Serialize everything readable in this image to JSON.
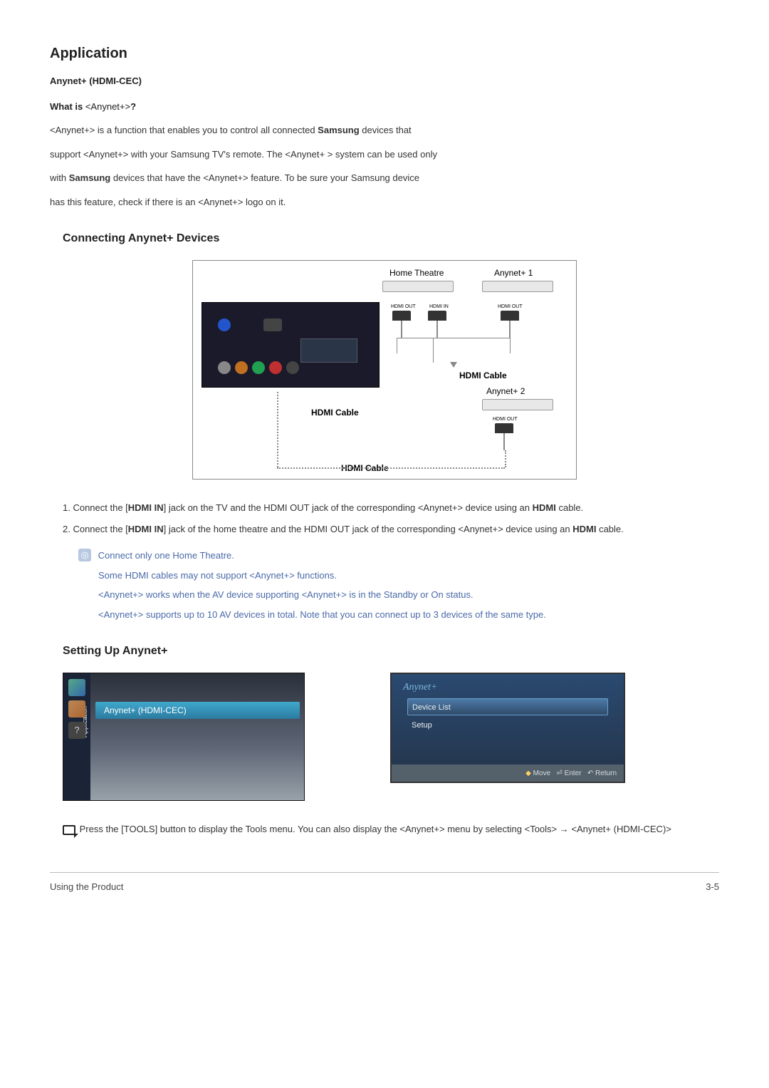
{
  "page_title": "Application",
  "feature_name": "Anynet+ (HDMI-CEC)",
  "what_is_html": "<b>What is </b><Anynet+><b>?</b>",
  "intro": {
    "l1_pre": "<Anynet+> is a function that enables you to control all connected ",
    "l1_bold": "Samsung",
    "l1_post": " devices that",
    "l2": "support <Anynet+> with your Samsung TV's remote. The <Anynet+ > system can be used only",
    "l3_pre": "with ",
    "l3_bold": "Samsung",
    "l3_post": " devices that have the <Anynet+> feature. To be sure your Samsung device",
    "l4": "has this feature, check if there is an <Anynet+> logo on it."
  },
  "section_connecting": "Connecting Anynet+ Devices",
  "diagram": {
    "home_theatre": "Home Theatre",
    "anynet1": "Anynet+ 1",
    "anynet2": "Anynet+ 2",
    "hdmi_cable": "HDMI Cable",
    "hdmi_out": "HDMI OUT",
    "hdmi_in": "HDMI IN"
  },
  "step1": {
    "pre": "1. Connect the [",
    "bold1": "HDMI IN",
    "mid": "] jack on the TV and the HDMI OUT jack of the corresponding <Anynet+> device using an ",
    "bold2": "HDMI",
    "post": " cable."
  },
  "step2": {
    "pre": "2. Connect the [",
    "bold1": "HDMI IN",
    "mid": "] jack of the home theatre and the HDMI OUT jack of the corresponding <Anynet+> device using an ",
    "bold2": "HDMI",
    "post": " cable."
  },
  "notes": [
    "Connect only one Home Theatre.",
    "Some HDMI cables may not support <Anynet+> functions.",
    "<Anynet+> works when the AV device supporting <Anynet+> is in the Standby or On status.",
    "<Anynet+> supports up to 10 AV devices in total. Note that you can connect up to 3 devices of the same type."
  ],
  "section_setting": "Setting Up Anynet+",
  "menu1": {
    "sidebar_label": "Application",
    "item": "Anynet+ (HDMI-CEC)"
  },
  "menu2": {
    "title": "Anynet+",
    "item1": "Device List",
    "item2": "Setup",
    "foot_move": "Move",
    "foot_enter": "Enter",
    "foot_return": "Return"
  },
  "tools_para": " Press the [TOOLS] button to display the Tools menu. You can also display the <Anynet+> menu by selecting <Tools> → <Anynet+ (HDMI-CEC)>",
  "footer_left": "Using the Product",
  "footer_right": "3-5"
}
